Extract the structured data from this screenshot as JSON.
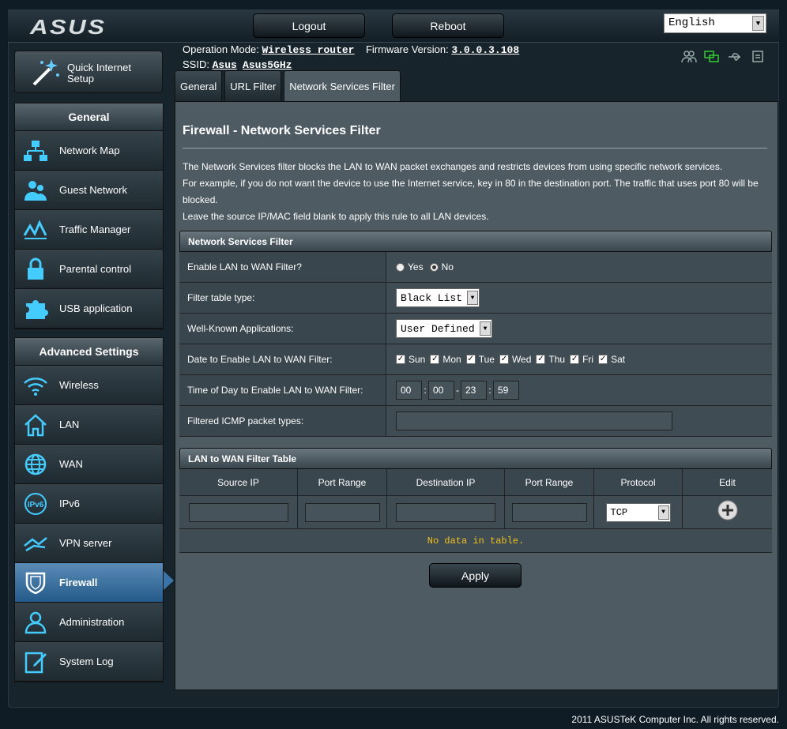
{
  "header": {
    "logo": "ASUS",
    "logout_label": "Logout",
    "reboot_label": "Reboot",
    "language": "English",
    "operation_mode_label": "Operation Mode:",
    "operation_mode_value": "Wireless router",
    "firmware_label": "Firmware Version:",
    "firmware_value": "3.0.0.3.108",
    "ssid_label": "SSID:",
    "ssid_1": "Asus",
    "ssid_2": "Asus5GHz"
  },
  "sidebar": {
    "quick_setup_label_1": "Quick Internet",
    "quick_setup_label_2": "Setup",
    "general_title": "General",
    "general_items": [
      {
        "label": "Network Map",
        "icon": "network-map-icon"
      },
      {
        "label": "Guest Network",
        "icon": "guest-network-icon"
      },
      {
        "label": "Traffic Manager",
        "icon": "traffic-manager-icon"
      },
      {
        "label": "Parental control",
        "icon": "lock-icon"
      },
      {
        "label": "USB application",
        "icon": "puzzle-icon"
      }
    ],
    "advanced_title": "Advanced Settings",
    "advanced_items": [
      {
        "label": "Wireless",
        "icon": "wifi-icon"
      },
      {
        "label": "LAN",
        "icon": "home-icon"
      },
      {
        "label": "WAN",
        "icon": "globe-icon"
      },
      {
        "label": "IPv6",
        "icon": "ipv6-icon"
      },
      {
        "label": "VPN server",
        "icon": "vpn-icon"
      },
      {
        "label": "Firewall",
        "icon": "shield-icon"
      },
      {
        "label": "Administration",
        "icon": "user-icon"
      },
      {
        "label": "System Log",
        "icon": "log-icon"
      }
    ]
  },
  "tabs": [
    "General",
    "URL Filter",
    "Network Services Filter"
  ],
  "page": {
    "title": "Firewall - Network Services Filter",
    "desc_1": "The Network Services filter blocks the LAN to WAN packet exchanges and restricts devices from using specific network services.",
    "desc_2": "For example, if you do not want the device to use the Internet service, key in 80 in the destination port. The traffic that uses port 80 will be blocked.",
    "desc_3": "Leave the source IP/MAC field blank to apply this rule to all LAN devices."
  },
  "filter": {
    "section_title": "Network Services Filter",
    "enable_label": "Enable LAN to WAN Filter?",
    "yes": "Yes",
    "no": "No",
    "table_type_label": "Filter table type:",
    "table_type_value": "Black List",
    "apps_label": "Well-Known Applications:",
    "apps_value": "User Defined",
    "date_label": "Date to Enable LAN to WAN Filter:",
    "days": [
      "Sun",
      "Mon",
      "Tue",
      "Wed",
      "Thu",
      "Fri",
      "Sat"
    ],
    "time_label": "Time of Day to Enable LAN to WAN Filter:",
    "time": [
      "00",
      "00",
      "23",
      "59"
    ],
    "icmp_label": "Filtered ICMP packet types:"
  },
  "table": {
    "section_title": "LAN to WAN Filter Table",
    "columns": [
      "Source IP",
      "Port Range",
      "Destination IP",
      "Port Range",
      "Protocol",
      "Edit"
    ],
    "protocol": "TCP",
    "no_data": "No data in table."
  },
  "apply_label": "Apply",
  "footer": "2011 ASUSTeK Computer Inc. All rights reserved."
}
